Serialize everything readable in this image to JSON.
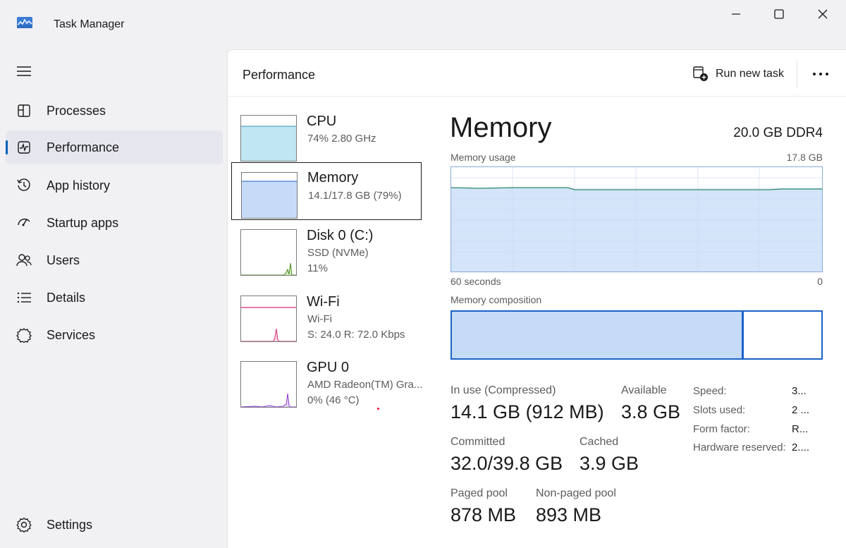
{
  "window": {
    "title": "Task Manager"
  },
  "sidebar": {
    "items": [
      {
        "label": "Processes",
        "icon": "processes-icon"
      },
      {
        "label": "Performance",
        "icon": "performance-icon",
        "active": true
      },
      {
        "label": "App history",
        "icon": "history-icon"
      },
      {
        "label": "Startup apps",
        "icon": "startup-icon"
      },
      {
        "label": "Users",
        "icon": "users-icon"
      },
      {
        "label": "Details",
        "icon": "details-icon"
      },
      {
        "label": "Services",
        "icon": "services-icon"
      }
    ],
    "settings_label": "Settings"
  },
  "header": {
    "title": "Performance",
    "run_new_task": "Run new task"
  },
  "devices": [
    {
      "name": "CPU",
      "sub1": "74%  2.80 GHz",
      "sub2": ""
    },
    {
      "name": "Memory",
      "sub1": "14.1/17.8 GB (79%)",
      "sub2": "",
      "selected": true
    },
    {
      "name": "Disk 0 (C:)",
      "sub1": "SSD (NVMe)",
      "sub2": "11%"
    },
    {
      "name": "Wi-Fi",
      "sub1": "Wi-Fi",
      "sub2": "S: 24.0  R: 72.0 Kbps"
    },
    {
      "name": "GPU 0",
      "sub1": "AMD Radeon(TM) Gra...",
      "sub2": "0%  (46 °C)"
    }
  ],
  "detail": {
    "title": "Memory",
    "spec": "20.0 GB DDR4",
    "usage_label": "Memory usage",
    "usage_max": "17.8 GB",
    "time_left": "60 seconds",
    "time_right": "0",
    "composition_label": "Memory composition",
    "composition_in_use_fraction": 0.79,
    "stats": {
      "in_use_label": "In use (Compressed)",
      "in_use_value": "14.1 GB (912 MB)",
      "available_label": "Available",
      "available_value": "3.8 GB",
      "committed_label": "Committed",
      "committed_value": "32.0/39.8 GB",
      "cached_label": "Cached",
      "cached_value": "3.9 GB",
      "paged_label": "Paged pool",
      "paged_value": "878 MB",
      "nonpaged_label": "Non-paged pool",
      "nonpaged_value": "893 MB"
    },
    "props": [
      {
        "label": "Speed:",
        "value": "3..."
      },
      {
        "label": "Slots used:",
        "value": "2 ..."
      },
      {
        "label": "Form factor:",
        "value": "R..."
      },
      {
        "label": "Hardware reserved:",
        "value": "2...."
      }
    ]
  },
  "colors": {
    "accent": "#005fb8",
    "memory_fill": "#c6dbf7",
    "memory_line": "#1a62c6",
    "cpu_fill": "#bfe6f2",
    "wifi_line": "#d4307a",
    "disk_line": "#4a8a1a",
    "gpu_line": "#8a3ad4"
  }
}
